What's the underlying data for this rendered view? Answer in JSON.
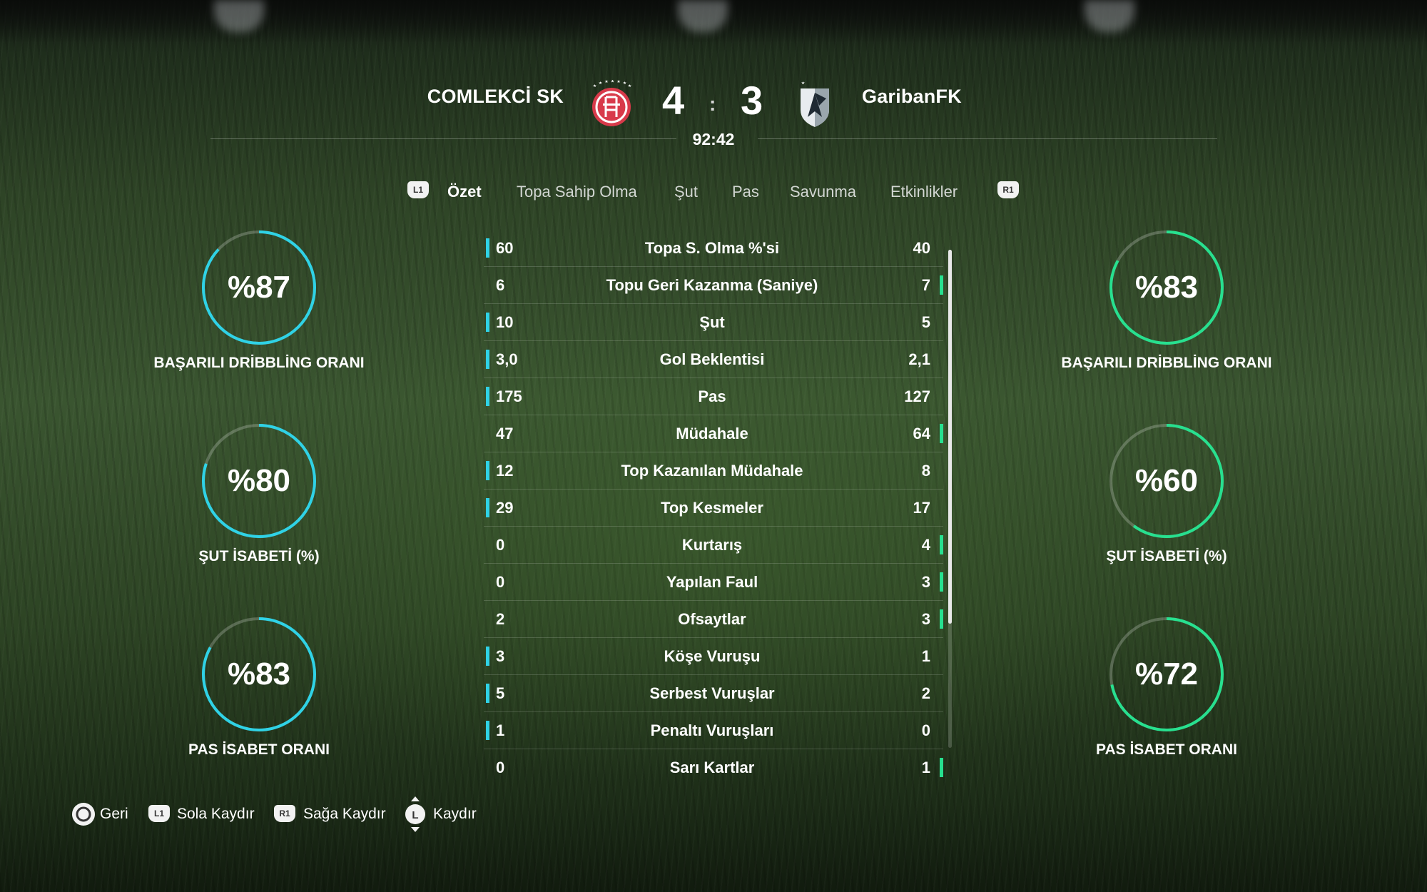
{
  "match": {
    "home_team": "COMLEKCİ SK",
    "away_team": "GaribanFK",
    "home_score": "4",
    "away_score": "3",
    "separator": ":",
    "clock": "92:42"
  },
  "tabs": {
    "left_button": "L1",
    "right_button": "R1",
    "items": [
      "Özet",
      "Topa Sahip Olma",
      "Şut",
      "Pas",
      "Savunma",
      "Etkinlikler"
    ],
    "active": "Özet"
  },
  "home_gauges": [
    {
      "value_text": "%87",
      "value": 87,
      "label": "BAŞARILI DRİBBLİNG ORANI"
    },
    {
      "value_text": "%80",
      "value": 80,
      "label": "ŞUT İSABETİ (%)"
    },
    {
      "value_text": "%83",
      "value": 83,
      "label": "PAS İSABET ORANI"
    }
  ],
  "away_gauges": [
    {
      "value_text": "%83",
      "value": 83,
      "label": "BAŞARILI DRİBBLİNG ORANI"
    },
    {
      "value_text": "%60",
      "value": 60,
      "label": "ŞUT İSABETİ (%)"
    },
    {
      "value_text": "%72",
      "value": 72,
      "label": "PAS İSABET ORANI"
    }
  ],
  "stats": [
    {
      "home": "60",
      "name": "Topa S. Olma %'si",
      "away": "40",
      "leader": "home"
    },
    {
      "home": "6",
      "name": "Topu Geri Kazanma (Saniye)",
      "away": "7",
      "leader": "away"
    },
    {
      "home": "10",
      "name": "Şut",
      "away": "5",
      "leader": "home"
    },
    {
      "home": "3,0",
      "name": "Gol Beklentisi",
      "away": "2,1",
      "leader": "home"
    },
    {
      "home": "175",
      "name": "Pas",
      "away": "127",
      "leader": "home"
    },
    {
      "home": "47",
      "name": "Müdahale",
      "away": "64",
      "leader": "away"
    },
    {
      "home": "12",
      "name": "Top Kazanılan Müdahale",
      "away": "8",
      "leader": "home"
    },
    {
      "home": "29",
      "name": "Top Kesmeler",
      "away": "17",
      "leader": "home"
    },
    {
      "home": "0",
      "name": "Kurtarış",
      "away": "4",
      "leader": "away"
    },
    {
      "home": "0",
      "name": "Yapılan Faul",
      "away": "3",
      "leader": "away"
    },
    {
      "home": "2",
      "name": "Ofsaytlar",
      "away": "3",
      "leader": "away"
    },
    {
      "home": "3",
      "name": "Köşe Vuruşu",
      "away": "1",
      "leader": "home"
    },
    {
      "home": "5",
      "name": "Serbest Vuruşlar",
      "away": "2",
      "leader": "home"
    },
    {
      "home": "1",
      "name": "Penaltı Vuruşları",
      "away": "0",
      "leader": "home"
    },
    {
      "home": "0",
      "name": "Sarı Kartlar",
      "away": "1",
      "leader": "away"
    }
  ],
  "scroll_fraction_visible": 0.75,
  "footer": {
    "back": {
      "button": "circle-button-icon",
      "label": "Geri"
    },
    "left": {
      "button": "L1",
      "label": "Sola Kaydır"
    },
    "right": {
      "button": "R1",
      "label": "Sağa Kaydır"
    },
    "scroll": {
      "button": "L",
      "label": "Kaydır"
    }
  },
  "colors": {
    "home_accent": "#2fd2e6",
    "away_accent": "#27e08f",
    "home_crest": "#d83a4a",
    "away_crest": "#e8ecef"
  }
}
